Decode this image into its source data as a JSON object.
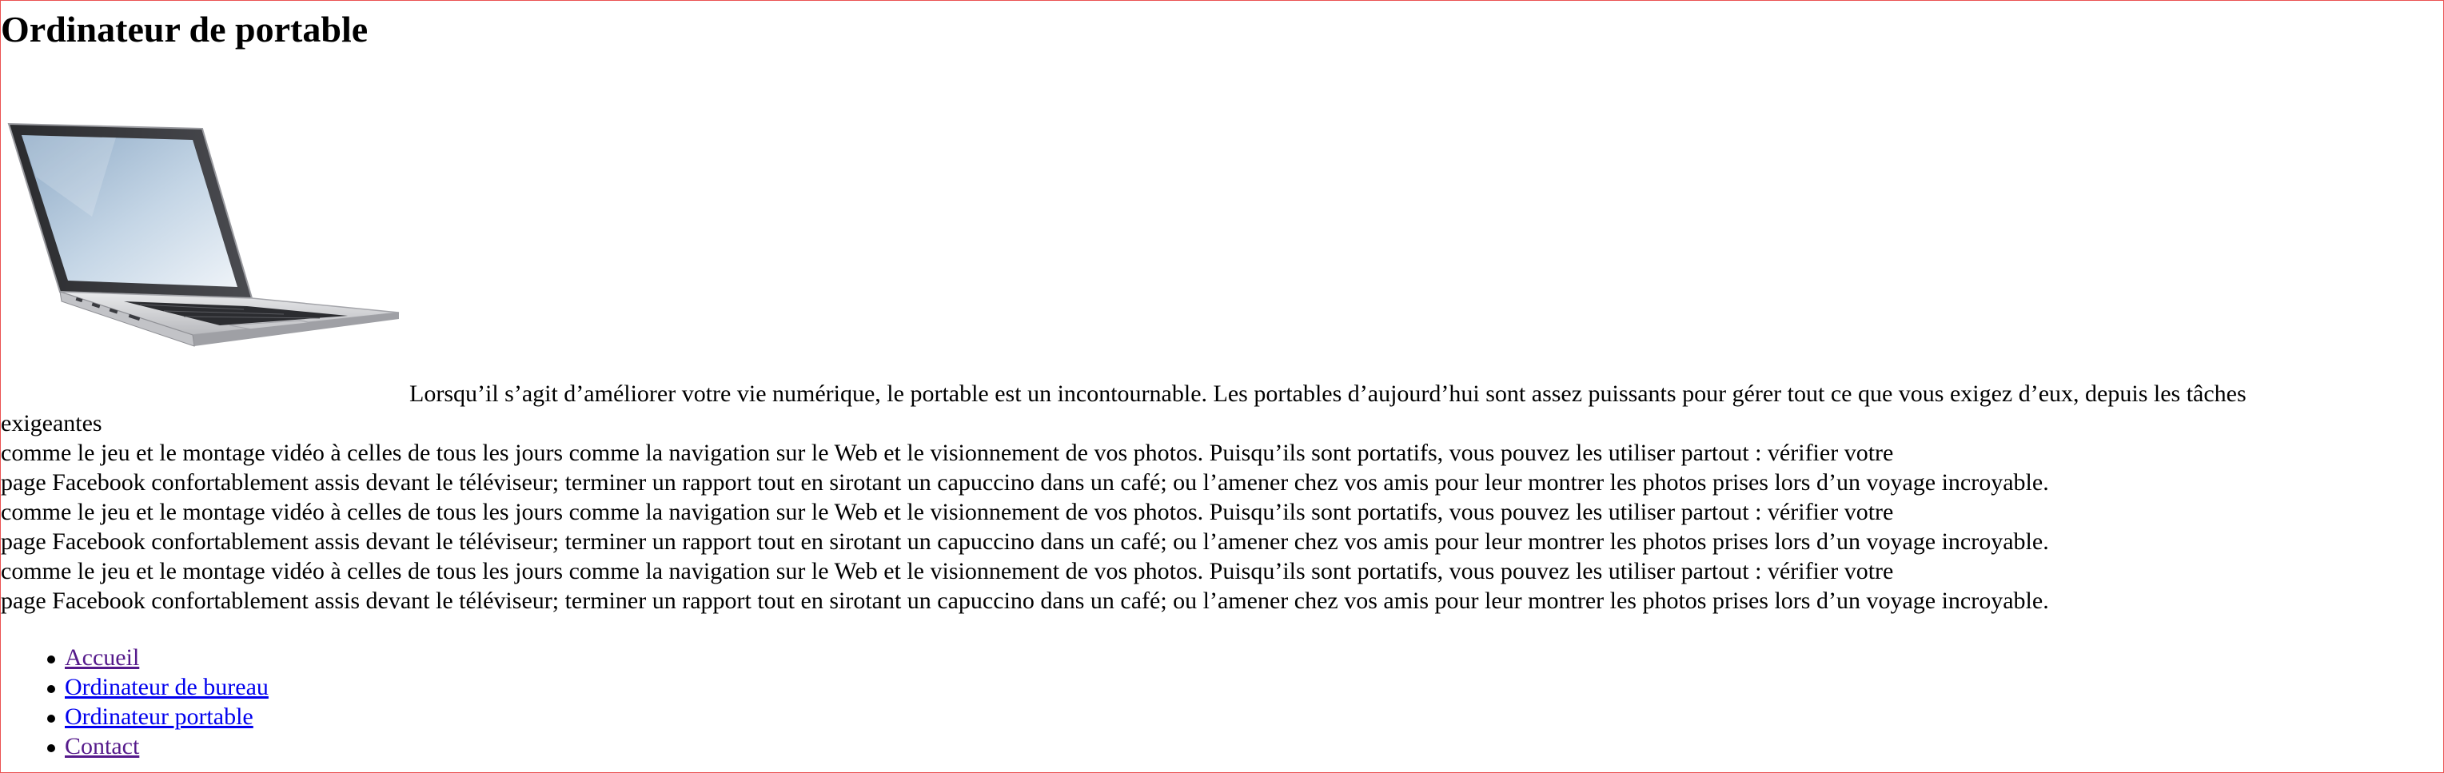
{
  "page": {
    "title": "Ordinateur de portable"
  },
  "image": {
    "subject": "laptop-computer",
    "colors": {
      "body": "#d9dadd",
      "screen_top": "#9fb8d0",
      "screen_bottom": "#e6eef5",
      "keys": "#2b2c30"
    }
  },
  "body_text": {
    "lines": [
      "Lorsqu’il s’agit d’améliorer votre vie numérique, le portable est un incontournable. Les portables d’aujourd’hui sont assez puissants pour gérer tout ce que vous exigez d’eux, depuis les tâches",
      "exigeantes",
      "comme le jeu et le montage vidéo à celles de tous les jours comme la navigation sur le Web et le visionnement de vos photos. Puisqu’ils sont portatifs, vous pouvez les utiliser partout : vérifier votre",
      "page Facebook confortablement assis devant le téléviseur; terminer un rapport tout en sirotant un capuccino dans un café; ou l’amener chez vos amis pour leur montrer les photos prises lors d’un voyage incroyable.",
      "comme le jeu et le montage vidéo à celles de tous les jours comme la navigation sur le Web et le visionnement de vos photos. Puisqu’ils sont portatifs, vous pouvez les utiliser partout : vérifier votre",
      "page Facebook confortablement assis devant le téléviseur; terminer un rapport tout en sirotant un capuccino dans un café; ou l’amener chez vos amis pour leur montrer les photos prises lors d’un voyage incroyable.",
      "comme le jeu et le montage vidéo à celles de tous les jours comme la navigation sur le Web et le visionnement de vos photos. Puisqu’ils sont portatifs, vous pouvez les utiliser partout : vérifier votre",
      "page Facebook confortablement assis devant le téléviseur; terminer un rapport tout en sirotant un capuccino dans un café; ou l’amener chez vos amis pour leur montrer les photos prises lors d’un voyage incroyable."
    ]
  },
  "nav": {
    "items": [
      {
        "label": "Accueil",
        "visited": true
      },
      {
        "label": "Ordinateur de bureau",
        "visited": false
      },
      {
        "label": "Ordinateur portable",
        "visited": false
      },
      {
        "label": "Contact",
        "visited": true
      }
    ]
  },
  "colors": {
    "link": "#0000ee",
    "visited_link": "#551a8b",
    "frame_border": "#ea5252",
    "text": "#000000",
    "background": "#ffffff"
  }
}
